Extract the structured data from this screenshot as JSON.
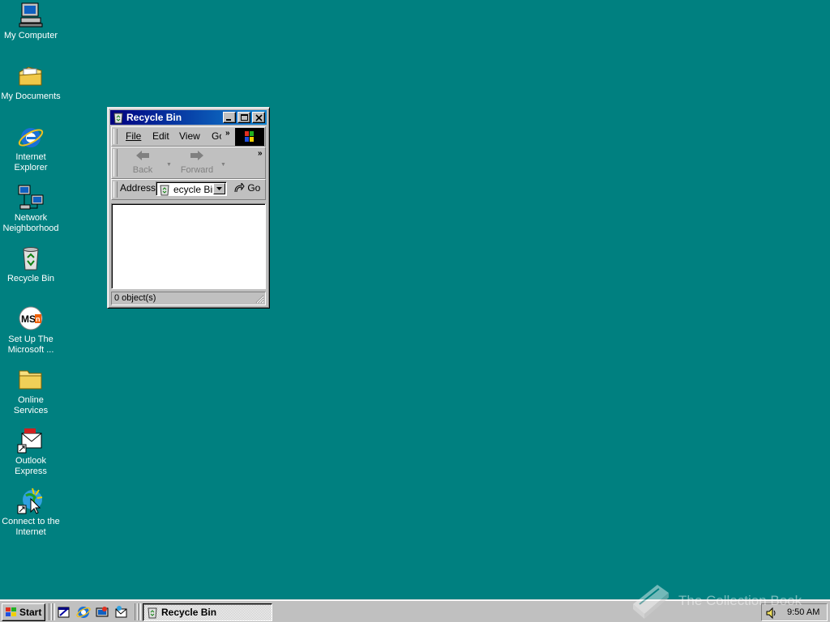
{
  "desktop": {
    "icons": [
      {
        "label_line1": "My Computer",
        "label_line2": "",
        "icon": "computer-icon"
      },
      {
        "label_line1": "My Documents",
        "label_line2": "",
        "icon": "documents-folder-icon"
      },
      {
        "label_line1": "Internet",
        "label_line2": "Explorer",
        "icon": "internet-explorer-icon"
      },
      {
        "label_line1": "Network",
        "label_line2": "Neighborhood",
        "icon": "network-icon"
      },
      {
        "label_line1": "Recycle Bin",
        "label_line2": "",
        "icon": "recycle-bin-icon"
      },
      {
        "label_line1": "Set Up The",
        "label_line2": "Microsoft ...",
        "icon": "msn-icon"
      },
      {
        "label_line1": "Online",
        "label_line2": "Services",
        "icon": "folder-icon"
      },
      {
        "label_line1": "Outlook",
        "label_line2": "Express",
        "icon": "outlook-express-icon"
      },
      {
        "label_line1": "Connect to the",
        "label_line2": "Internet",
        "icon": "connect-wizard-icon"
      }
    ],
    "background_color": "#008080"
  },
  "window": {
    "title": "Recycle Bin",
    "menu": {
      "file": "File",
      "edit": "Edit",
      "view": "View",
      "go": "Go",
      "chevron": "»"
    },
    "toolbar": {
      "back": "Back",
      "forward": "Forward",
      "chevron": "»"
    },
    "address": {
      "label": "Address",
      "value": "ecycle Bin",
      "go": "Go"
    },
    "status": "0 object(s)"
  },
  "taskbar": {
    "start": "Start",
    "task": "Recycle Bin",
    "clock": "9:50 AM"
  },
  "watermark": {
    "text": "The Collection Book"
  }
}
